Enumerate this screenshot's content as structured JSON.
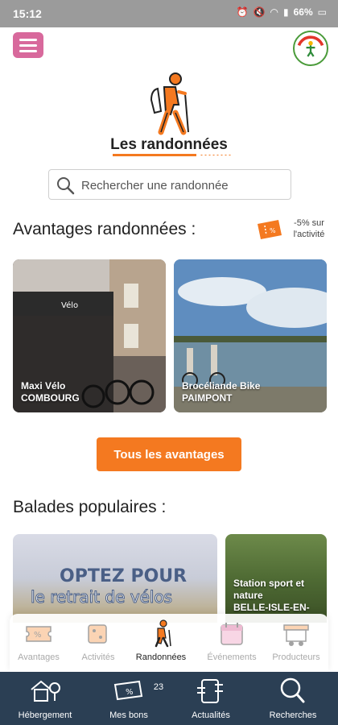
{
  "status_bar": {
    "time": "15:12",
    "battery": "66%"
  },
  "header": {
    "menu_icon": "hamburger-icon",
    "logo_icon": "brand-logo"
  },
  "page": {
    "title": "Les randonnées",
    "hero_icon": "hiker-icon"
  },
  "search": {
    "placeholder": "Rechercher une randonnée"
  },
  "advantages": {
    "title": "Avantages randonnées :",
    "discount_note": "-5% sur l'activité",
    "cards": [
      {
        "label_line1": "Maxi Vélo",
        "label_line2": "COMBOURG"
      },
      {
        "label_line1": "Brocéliande Bike",
        "label_line2": "PAIMPONT"
      }
    ],
    "cta_label": "Tous les avantages"
  },
  "popular": {
    "title": "Balades populaires :",
    "cards": [
      {
        "promo_line1": "OPTEZ POUR",
        "promo_line2": "le retrait de vélos"
      },
      {
        "label_line1": "Station sport et",
        "label_line2": "nature",
        "label_line3": "BELLE-ISLE-EN-"
      }
    ]
  },
  "tabs": [
    {
      "label": "Avantages",
      "icon": "ticket-icon",
      "active": false
    },
    {
      "label": "Activités",
      "icon": "activities-icon",
      "active": false
    },
    {
      "label": "Randonnées",
      "icon": "hiker-icon",
      "active": true
    },
    {
      "label": "Événements",
      "icon": "calendar-icon",
      "active": false
    },
    {
      "label": "Producteurs",
      "icon": "market-stall-icon",
      "active": false
    }
  ],
  "bottom_nav": [
    {
      "label": "Hébergement",
      "icon": "house-icon"
    },
    {
      "label": "Mes bons",
      "icon": "voucher-icon",
      "badge": "23"
    },
    {
      "label": "Actualités",
      "icon": "news-icon"
    },
    {
      "label": "Recherches",
      "icon": "search-icon"
    }
  ],
  "colors": {
    "accent": "#f47920",
    "menu": "#d8699c",
    "nav_bg": "#2b3f54"
  }
}
